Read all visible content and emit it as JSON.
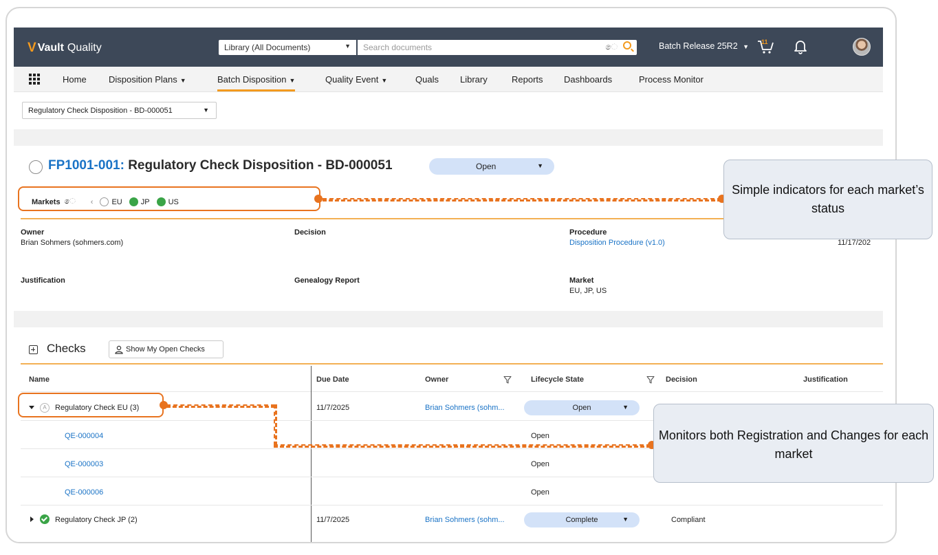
{
  "app": {
    "logo_mark": "V",
    "logo_name": "Vault",
    "logo_sub": "Quality",
    "library_select": "Library (All Documents)",
    "search_placeholder": "Search documents",
    "batch_release": "Batch Release 25R2",
    "cart_count": "11"
  },
  "nav": {
    "items": [
      "Home",
      "Disposition Plans",
      "Batch Disposition",
      "Quality Event",
      "Quals",
      "Library",
      "Reports",
      "Dashboards",
      "Process Monitor"
    ],
    "active": "Batch Disposition"
  },
  "view_select": "Regulatory Check Disposition - BD-000051",
  "record": {
    "id": "FP1001-001:",
    "title": "Regulatory Check Disposition - BD-000051",
    "status": "Open",
    "markets_label": "Markets",
    "markets": [
      {
        "name": "EU",
        "state": "empty"
      },
      {
        "name": "JP",
        "state": "green"
      },
      {
        "name": "US",
        "state": "green"
      }
    ]
  },
  "fields": {
    "owner_label": "Owner",
    "owner_value": "Brian Sohmers (sohmers.com)",
    "decision_label": "Decision",
    "procedure_label": "Procedure",
    "procedure_value": "Disposition Procedure (v1.0)",
    "date_value": "11/17/202",
    "justification_label": "Justification",
    "genealogy_label": "Genealogy Report",
    "market_label": "Market",
    "market_value": "EU, JP, US"
  },
  "checks": {
    "title": "Checks",
    "show_button": "Show My Open Checks",
    "columns": [
      "Name",
      "Due Date",
      "Owner",
      "Lifecycle State",
      "Decision",
      "Justification"
    ],
    "rows": [
      {
        "name": "Regulatory Check EU (3)",
        "due": "11/7/2025",
        "owner": "Brian Sohmers (sohm...",
        "state": "Open",
        "decision": ""
      },
      {
        "name": "QE-000004",
        "state": "Open"
      },
      {
        "name": "QE-000003",
        "state": "Open"
      },
      {
        "name": "QE-000006",
        "state": "Open"
      },
      {
        "name": "Regulatory Check JP (2)",
        "due": "11/7/2025",
        "owner": "Brian Sohmers (sohm...",
        "state": "Complete",
        "decision": "Compliant"
      }
    ]
  },
  "callouts": {
    "markets": "Simple indicators for each market’s status",
    "checks": "Monitors both Registration and Changes for each market"
  },
  "colors": {
    "accent": "#e8731f",
    "brand_orange": "#f39a1e",
    "header_bg": "#3d4858",
    "link": "#1a73c6",
    "status_green": "#3aa447",
    "pill_bg": "#d3e2f8"
  }
}
